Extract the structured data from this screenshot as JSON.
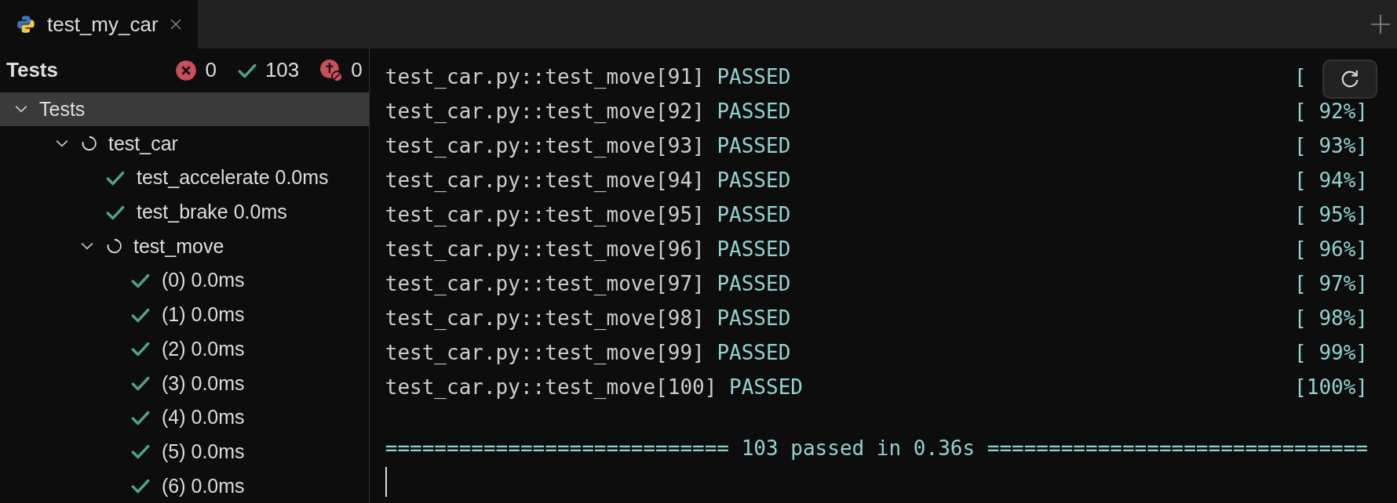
{
  "tabs": [
    {
      "label": "test_my_car",
      "selected": true
    }
  ],
  "sidebar": {
    "title": "Tests",
    "counters": [
      {
        "kind": "failed",
        "count": "0"
      },
      {
        "kind": "passed",
        "count": "103"
      },
      {
        "kind": "skipped",
        "count": "0"
      }
    ],
    "tree": [
      {
        "label": "Tests",
        "selected": true,
        "expanded": true,
        "children": [
          {
            "label": "test_car",
            "kind": "running",
            "selected": false,
            "expanded": true,
            "children": [
              {
                "label": "test_accelerate 0.0ms",
                "kind": "passed",
                "selected": false
              },
              {
                "label": "test_brake 0.0ms",
                "kind": "passed",
                "selected": false
              },
              {
                "label": "test_move",
                "kind": "running",
                "selected": false,
                "expanded": true,
                "children": [
                  {
                    "label": "(0) 0.0ms",
                    "kind": "passed",
                    "selected": false
                  },
                  {
                    "label": "(1) 0.0ms",
                    "kind": "passed",
                    "selected": false
                  },
                  {
                    "label": "(2) 0.0ms",
                    "kind": "passed",
                    "selected": false
                  },
                  {
                    "label": "(3) 0.0ms",
                    "kind": "passed",
                    "selected": false
                  },
                  {
                    "label": "(4) 0.0ms",
                    "kind": "passed",
                    "selected": false
                  },
                  {
                    "label": "(5) 0.0ms",
                    "kind": "passed",
                    "selected": false
                  },
                  {
                    "label": "(6) 0.0ms",
                    "kind": "passed",
                    "selected": false
                  }
                ]
              }
            ]
          }
        ]
      }
    ]
  },
  "console": {
    "lines": [
      {
        "test": "test_car.py::test_move[91]",
        "result": "PASSED",
        "progress": "["
      },
      {
        "test": "test_car.py::test_move[92]",
        "result": "PASSED",
        "progress": "[ 92%]"
      },
      {
        "test": "test_car.py::test_move[93]",
        "result": "PASSED",
        "progress": "[ 93%]"
      },
      {
        "test": "test_car.py::test_move[94]",
        "result": "PASSED",
        "progress": "[ 94%]"
      },
      {
        "test": "test_car.py::test_move[95]",
        "result": "PASSED",
        "progress": "[ 95%]"
      },
      {
        "test": "test_car.py::test_move[96]",
        "result": "PASSED",
        "progress": "[ 96%]"
      },
      {
        "test": "test_car.py::test_move[97]",
        "result": "PASSED",
        "progress": "[ 97%]"
      },
      {
        "test": "test_car.py::test_move[98]",
        "result": "PASSED",
        "progress": "[ 98%]"
      },
      {
        "test": "test_car.py::test_move[99]",
        "result": "PASSED",
        "progress": "[ 99%]"
      },
      {
        "test": "test_car.py::test_move[100]",
        "result": "PASSED",
        "progress": "[100%]"
      }
    ],
    "summary": "============================ 103 passed in 0.36s ==============================="
  }
}
